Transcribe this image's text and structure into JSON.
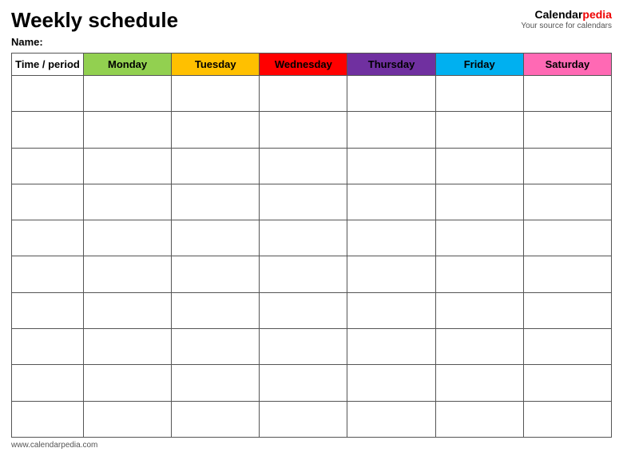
{
  "header": {
    "title": "Weekly schedule",
    "brand_name_part1": "Calendar",
    "brand_name_part2": "pedia",
    "brand_tagline": "Your source for calendars",
    "name_label": "Name:"
  },
  "table": {
    "columns": [
      {
        "key": "time",
        "label": "Time / period",
        "class": "col-time"
      },
      {
        "key": "monday",
        "label": "Monday",
        "class": "col-monday"
      },
      {
        "key": "tuesday",
        "label": "Tuesday",
        "class": "col-tuesday"
      },
      {
        "key": "wednesday",
        "label": "Wednesday",
        "class": "col-wednesday"
      },
      {
        "key": "thursday",
        "label": "Thursday",
        "class": "col-thursday"
      },
      {
        "key": "friday",
        "label": "Friday",
        "class": "col-friday"
      },
      {
        "key": "saturday",
        "label": "Saturday",
        "class": "col-saturday"
      }
    ],
    "row_count": 10
  },
  "footer": {
    "url": "www.calendarpedia.com"
  }
}
